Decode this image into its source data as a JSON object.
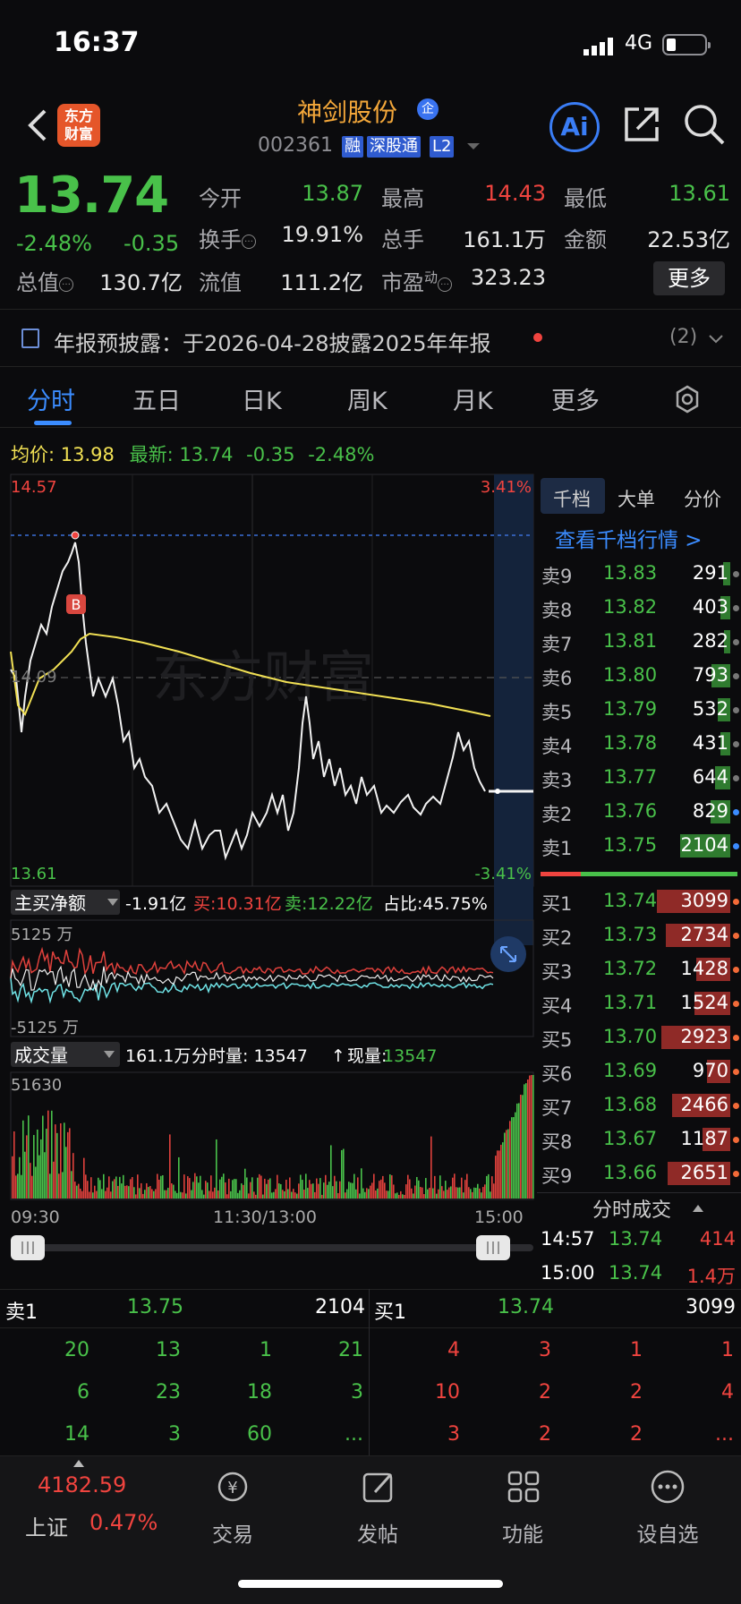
{
  "status": {
    "time": "16:37",
    "network": "4G"
  },
  "header": {
    "logo": "东方\n财富",
    "name": "神剑股份",
    "badge": "企",
    "code": "002361",
    "tags": [
      "融",
      "深股通",
      "L2"
    ]
  },
  "quote": {
    "price": "13.74",
    "pct": "-2.48%",
    "chg": "-0.35",
    "fields": [
      {
        "label": "今开",
        "value": "13.87",
        "color": "green"
      },
      {
        "label": "最高",
        "value": "14.43",
        "color": "red"
      },
      {
        "label": "最低",
        "value": "13.61",
        "color": "green"
      },
      {
        "label": "换手",
        "value": "19.91%",
        "color": "white"
      },
      {
        "label": "总手",
        "value": "161.1万",
        "color": "white"
      },
      {
        "label": "金额",
        "value": "22.53亿",
        "color": "white"
      },
      {
        "label": "总值",
        "value": "130.7亿",
        "color": "white"
      },
      {
        "label": "流值",
        "value": "111.2亿",
        "color": "white"
      },
      {
        "label": "市盈",
        "sup": "动",
        "value": "323.23",
        "color": "white"
      }
    ],
    "more": "更多"
  },
  "notice": {
    "text": "年报预披露：于2026-04-28披露2025年年报",
    "count": "(2)"
  },
  "tabs": [
    "分时",
    "五日",
    "日K",
    "周K",
    "月K",
    "更多"
  ],
  "avgbar": {
    "avg_label": "均价:",
    "avg": "13.98",
    "latest_label": "最新:",
    "latest": "13.74",
    "chg": "-0.35",
    "pct": "-2.48%"
  },
  "chart": {
    "ymax": "14.57",
    "ymin": "13.61",
    "pmax": "3.41%",
    "pmin": "-3.41%",
    "mid": "14.09",
    "marker": "B",
    "netbuy_label": "主买净额",
    "netbuy": "-1.91亿",
    "buy": "买:10.31亿",
    "sell": "卖:12.22亿",
    "ratio": "占比:45.75%",
    "flow_max": "5125 万",
    "flow_min": "-5125 万",
    "vol_label": "成交量",
    "vol_total": "161.1万",
    "vol_min": "分时量: 13547",
    "vol_now_label": "现量:",
    "vol_now": "13547",
    "vol_max": "51630",
    "times": [
      "09:30",
      "11:30/13:00",
      "15:00"
    ]
  },
  "chart_data": {
    "type": "line",
    "price_range": [
      13.61,
      14.57
    ],
    "high": 14.43,
    "low": 13.61,
    "prev_close": 14.09,
    "avg": 13.98,
    "last": 13.74
  },
  "orderbook": {
    "tabs": [
      "千档",
      "大单",
      "分价"
    ],
    "link": "查看千档行情 >",
    "asks": [
      {
        "label": "卖9",
        "price": "13.83",
        "vol": "291"
      },
      {
        "label": "卖8",
        "price": "13.82",
        "vol": "403"
      },
      {
        "label": "卖7",
        "price": "13.81",
        "vol": "282"
      },
      {
        "label": "卖6",
        "price": "13.80",
        "vol": "793"
      },
      {
        "label": "卖5",
        "price": "13.79",
        "vol": "532"
      },
      {
        "label": "卖4",
        "price": "13.78",
        "vol": "431"
      },
      {
        "label": "卖3",
        "price": "13.77",
        "vol": "644"
      },
      {
        "label": "卖2",
        "price": "13.76",
        "vol": "829"
      },
      {
        "label": "卖1",
        "price": "13.75",
        "vol": "2104"
      }
    ],
    "bids": [
      {
        "label": "买1",
        "price": "13.74",
        "vol": "3099"
      },
      {
        "label": "买2",
        "price": "13.73",
        "vol": "2734"
      },
      {
        "label": "买3",
        "price": "13.72",
        "vol": "1428"
      },
      {
        "label": "买4",
        "price": "13.71",
        "vol": "1524"
      },
      {
        "label": "买5",
        "price": "13.70",
        "vol": "2923"
      },
      {
        "label": "买6",
        "price": "13.69",
        "vol": "970"
      },
      {
        "label": "买7",
        "price": "13.68",
        "vol": "2466"
      },
      {
        "label": "买8",
        "price": "13.67",
        "vol": "1187"
      },
      {
        "label": "买9",
        "price": "13.66",
        "vol": "2651"
      }
    ],
    "trades_label": "分时成交",
    "trades": [
      {
        "time": "14:57",
        "price": "13.74",
        "vol": "414"
      },
      {
        "time": "15:00",
        "price": "13.74",
        "vol": "1.4万"
      }
    ]
  },
  "bottom": {
    "sell_label": "卖1",
    "sell_price": "13.75",
    "sell_vol": "2104",
    "buy_label": "买1",
    "buy_price": "13.74",
    "buy_vol": "3099",
    "sell_rows": [
      [
        "20",
        "13",
        "1",
        "21"
      ],
      [
        "6",
        "23",
        "18",
        "3"
      ],
      [
        "14",
        "3",
        "60",
        "..."
      ]
    ],
    "buy_rows": [
      [
        "4",
        "3",
        "1",
        "1"
      ],
      [
        "10",
        "2",
        "2",
        "4"
      ],
      [
        "3",
        "2",
        "2",
        "..."
      ]
    ]
  },
  "tabbar": {
    "index_value": "4182.59",
    "index_name": "上证",
    "index_pct": "0.47%",
    "items": [
      "交易",
      "发帖",
      "功能",
      "设自选"
    ]
  }
}
